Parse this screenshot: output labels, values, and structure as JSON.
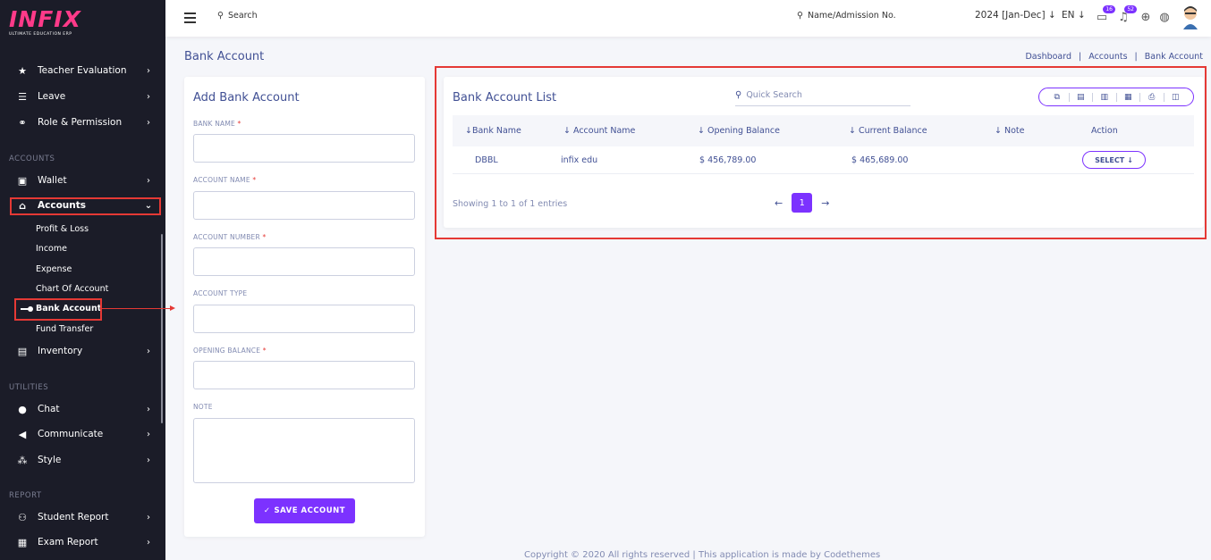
{
  "logo": {
    "text": "INFIX",
    "subtitle": "ULTIMATE EDUCATION ERP"
  },
  "sidebar": {
    "items_top": [
      {
        "label": "Teacher Evaluation",
        "icon": "star-icon"
      },
      {
        "label": "Leave",
        "icon": "leave-icon"
      },
      {
        "label": "Role & Permission",
        "icon": "role-icon"
      }
    ],
    "section_accounts": "ACCOUNTS",
    "wallet": "Wallet",
    "accounts": "Accounts",
    "accounts_sub": [
      "Profit & Loss",
      "Income",
      "Expense",
      "Chart Of Account",
      "Bank Account",
      "Fund Transfer"
    ],
    "inventory": "Inventory",
    "section_utilities": "UTILITIES",
    "utilities": [
      "Chat",
      "Communicate",
      "Style"
    ],
    "section_report": "REPORT",
    "reports": [
      "Student Report",
      "Exam Report"
    ]
  },
  "header": {
    "search_label": "Search",
    "admission_placeholder": "Name/Admission No.",
    "session": "2024 [Jan-Dec]",
    "language": "EN",
    "chat_badge": "16",
    "notification_badge": "52"
  },
  "page": {
    "title": "Bank Account",
    "breadcrumb": [
      "Dashboard",
      "Accounts",
      "Bank Account"
    ]
  },
  "form": {
    "title": "Add Bank Account",
    "fields": [
      {
        "label": "BANK NAME",
        "required": "*"
      },
      {
        "label": "ACCOUNT NAME",
        "required": "*"
      },
      {
        "label": "ACCOUNT NUMBER",
        "required": "*"
      },
      {
        "label": "ACCOUNT TYPE",
        "required": ""
      },
      {
        "label": "OPENING BALANCE",
        "required": "*"
      },
      {
        "label": "NOTE",
        "required": ""
      }
    ],
    "save_label": "SAVE ACCOUNT"
  },
  "list": {
    "title": "Bank Account List",
    "quick_search_placeholder": "Quick Search",
    "columns": [
      "Bank Name",
      "Account Name",
      "Opening Balance",
      "Current Balance",
      "Note",
      "Action"
    ],
    "rows": [
      {
        "bank_name": "DBBL",
        "account_name": "infix edu",
        "opening_balance": "$ 456,789.00",
        "current_balance": "$ 465,689.00",
        "note": "",
        "action": "SELECT"
      }
    ],
    "showing": "Showing 1 to 1 of 1 entries",
    "current_page": "1"
  },
  "footer": "Copyright © 2020 All rights reserved | This application is made by Codethemes"
}
